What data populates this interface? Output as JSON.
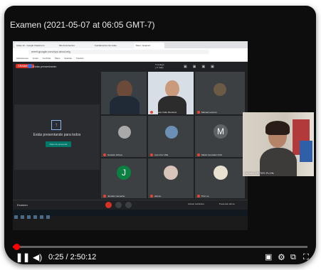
{
  "video": {
    "title": "Examen (2021-05-07 at 06:05 GMT-7)",
    "current_time": "0:25",
    "duration": "2:50:12",
    "progress_fraction": 0.0025
  },
  "browser": {
    "tabs": [
      "Clase 12 - Google Classroom",
      "Mis documentos",
      "Fundamentos de redes",
      "Meet - Examen"
    ],
    "url": "meet.google.com/xyz-abcd-efg",
    "bookmarks": [
      "Aplicaciones",
      "Gmail",
      "YouTube",
      "Maps",
      "Noticias",
      "Traducir"
    ]
  },
  "meet": {
    "live_badge": "GRABANDO",
    "presenting_label": "Estás presentando",
    "host_name_line1": "Tú (Hugo",
    "host_name_line2": "y 2 más)",
    "presenting_panel_text": "Estás presentando para todos",
    "stop_button": "Dejar de presentar",
    "participants": [
      {
        "name": "Participante 1",
        "type": "video"
      },
      {
        "name": "Rosario Calle Mendoza",
        "type": "video"
      },
      {
        "name": "Manuel Lorenzo",
        "type": "photo"
      },
      {
        "name": "Gerardo Ochoa",
        "type": "photo"
      },
      {
        "name": "Luis Cruz Villa",
        "type": "photo"
      },
      {
        "name": "Martin Gonzalez Ortiz",
        "type": "avatar",
        "initial": "M",
        "color": "#5f6368"
      },
      {
        "name": "Jennifer Camacho",
        "type": "avatar",
        "initial": "J",
        "color": "#0b8043"
      },
      {
        "name": "Alonso",
        "type": "photo"
      },
      {
        "name": "Prof. ux",
        "type": "photo"
      }
    ],
    "meeting_code": "Examen",
    "bottom_right_1": "Activar subtítulos",
    "bottom_right_2": "Presentar ahora"
  },
  "right_camera": {
    "label": "DIANA CORTES FLON"
  },
  "colors": {
    "progress": "#ff0000",
    "meet_bg": "#202124",
    "accent": "#1a73e8"
  }
}
